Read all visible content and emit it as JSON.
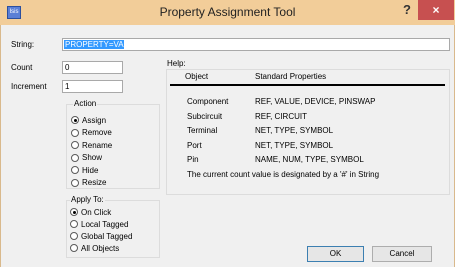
{
  "window": {
    "title": "Property Assignment Tool",
    "icon_text": "Isis",
    "help": "?",
    "close": "×"
  },
  "labels": {
    "string": "String:",
    "count": "Count",
    "increment": "Increment"
  },
  "fields": {
    "string_value": "PROPERTY=VALUE",
    "count_value": "0",
    "increment_value": "1"
  },
  "action": {
    "title": "Action",
    "options": [
      {
        "label": "Assign",
        "checked": true
      },
      {
        "label": "Remove",
        "checked": false
      },
      {
        "label": "Rename",
        "checked": false
      },
      {
        "label": "Show",
        "checked": false
      },
      {
        "label": "Hide",
        "checked": false
      },
      {
        "label": "Resize",
        "checked": false
      }
    ]
  },
  "apply": {
    "title": "Apply To:",
    "options": [
      {
        "label": "On Click",
        "checked": true
      },
      {
        "label": "Local Tagged",
        "checked": false
      },
      {
        "label": "Global Tagged",
        "checked": false
      },
      {
        "label": "All Objects",
        "checked": false
      }
    ]
  },
  "help": {
    "title": "Help:",
    "col_object": "Object",
    "col_props": "Standard Properties",
    "rows": [
      {
        "object": "Component",
        "props": "REF, VALUE, DEVICE, PINSWAP"
      },
      {
        "object": "Subcircuit",
        "props": "REF, CIRCUIT"
      },
      {
        "object": "Terminal",
        "props": "NET, TYPE, SYMBOL"
      },
      {
        "object": "Port",
        "props": "NET, TYPE, SYMBOL"
      },
      {
        "object": "Pin",
        "props": "NAME, NUM, TYPE, SYMBOL"
      }
    ],
    "note": "The current count value is designated by a '#' in String"
  },
  "buttons": {
    "ok": "OK",
    "cancel": "Cancel"
  }
}
